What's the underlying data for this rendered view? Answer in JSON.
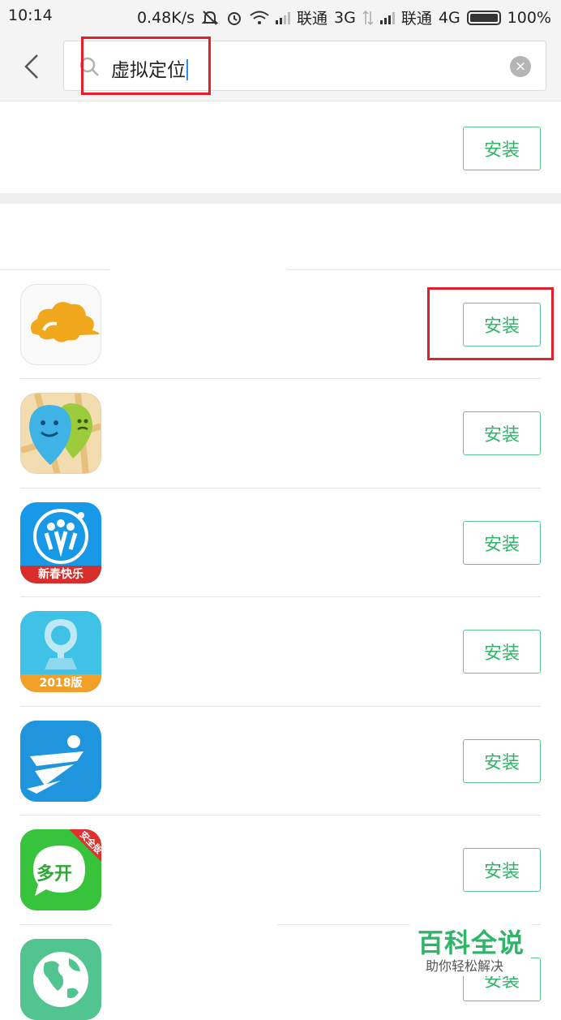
{
  "status_bar": {
    "time": "10:14",
    "speed": "0.48K/s",
    "carrier1": "联通",
    "net1": "3G",
    "carrier2": "联通",
    "net2": "4G",
    "battery": "100%"
  },
  "search": {
    "value": "虚拟定位",
    "icons": [
      "back-arrow-icon",
      "search-icon",
      "clear-icon"
    ]
  },
  "install_label": "安装",
  "apps": [
    {
      "icon": "cloud-app-icon",
      "label": ""
    },
    {
      "icon": "map-pins-app-icon",
      "label": ""
    },
    {
      "icon": "people-logo-app-icon",
      "label": "新春快乐"
    },
    {
      "icon": "location-pin-app-icon",
      "label": "2018版"
    },
    {
      "icon": "runner-app-icon",
      "label": ""
    },
    {
      "icon": "multi-open-app-icon",
      "label": "多开",
      "badge": "安全版"
    },
    {
      "icon": "globe-app-icon",
      "label": ""
    }
  ],
  "watermark": {
    "title": "百科全说",
    "subtitle": "助你轻松解决"
  },
  "colors": {
    "accent_green": "#2fb568",
    "highlight_red": "#e21f2a"
  }
}
